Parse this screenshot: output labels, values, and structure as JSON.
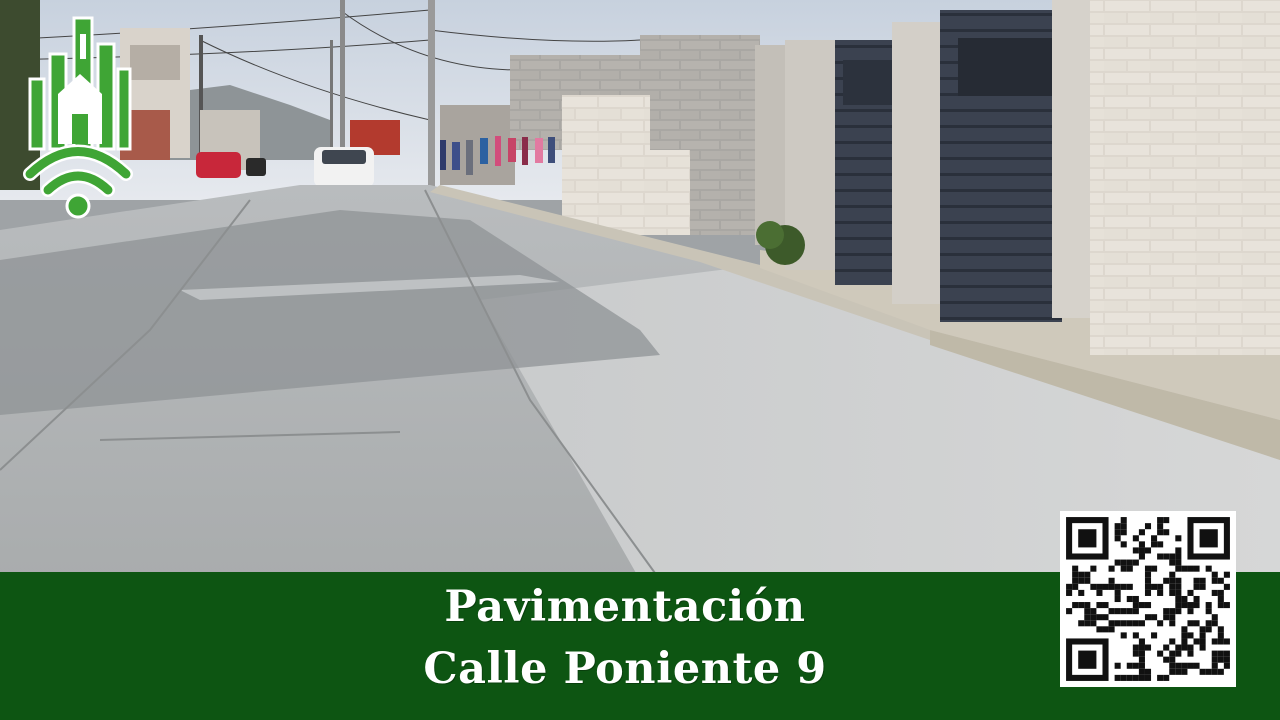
{
  "banner": {
    "line1": "Pavimentación",
    "line2": "Calle Poniente 9",
    "color": "#0d5512",
    "text_color": "#ffffff"
  },
  "logo": {
    "icon": "green-building-bars-with-wifi-icon",
    "color": "#3fa535"
  },
  "qr_code": {
    "icon": "qr-code-icon"
  }
}
